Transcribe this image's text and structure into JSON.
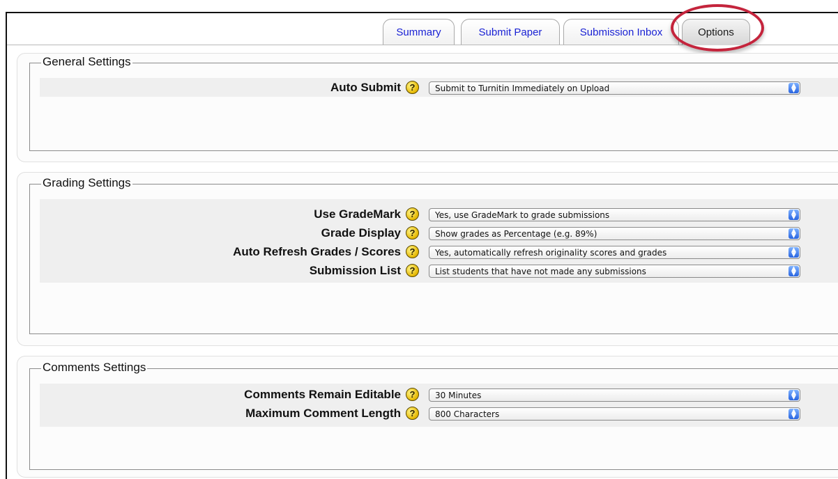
{
  "tabs": [
    {
      "label": "Summary",
      "active": false
    },
    {
      "label": "Submit Paper",
      "active": false
    },
    {
      "label": "Submission Inbox",
      "active": false
    },
    {
      "label": "Options",
      "active": true
    }
  ],
  "help_glyph": "?",
  "sections": [
    {
      "legend": "General Settings",
      "rows": [
        {
          "label": "Auto Submit",
          "value": "Submit to Turnitin Immediately on Upload"
        }
      ]
    },
    {
      "legend": "Grading Settings",
      "rows": [
        {
          "label": "Use GradeMark",
          "value": "Yes, use GradeMark to grade submissions"
        },
        {
          "label": "Grade Display",
          "value": "Show grades as Percentage (e.g. 89%)"
        },
        {
          "label": "Auto Refresh Grades / Scores",
          "value": "Yes, automatically refresh originality scores and grades"
        },
        {
          "label": "Submission List",
          "value": "List students that have not made any submissions"
        }
      ]
    },
    {
      "legend": "Comments Settings",
      "rows": [
        {
          "label": "Comments Remain Editable",
          "value": "30 Minutes"
        },
        {
          "label": "Maximum Comment Length",
          "value": "800 Characters"
        }
      ]
    }
  ],
  "colors": {
    "tab_link": "#1a22d4",
    "highlight_ring": "#c4243c",
    "row_background": "#efefef",
    "help_icon": "#e5b700",
    "select_arrow": "#2864e0"
  },
  "icons": {
    "help": "help-question-icon",
    "select": "select-arrows-icon"
  }
}
